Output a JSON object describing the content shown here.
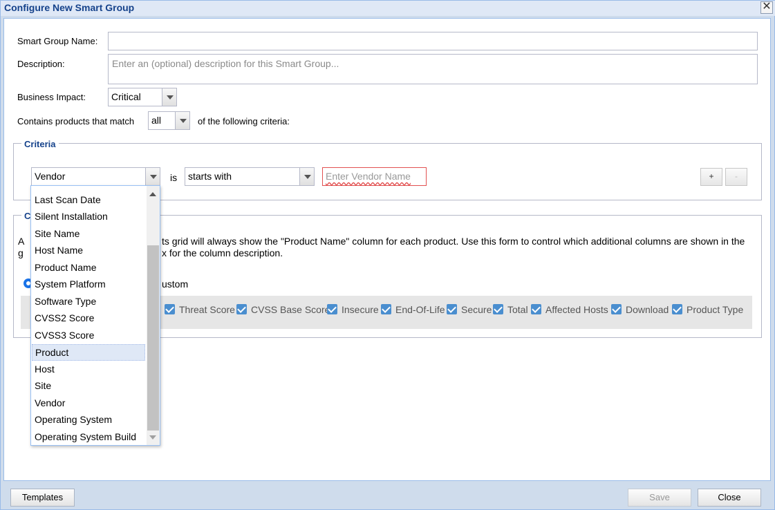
{
  "dialog": {
    "title": "Configure New Smart Group",
    "close_glyph": "✕"
  },
  "form": {
    "name_label": "Smart Group Name:",
    "name_value": "",
    "description_label": "Description:",
    "description_placeholder": "Enter an (optional) description for this Smart Group...",
    "impact_label": "Business Impact:",
    "impact_value": "Critical",
    "match_prefix": "Contains products that match",
    "match_value": "all",
    "match_suffix": "of the following criteria:"
  },
  "criteria": {
    "legend": "Criteria",
    "field_value": "Vendor",
    "is_label": "is",
    "operator_value": "starts with",
    "value_placeholder": "Enter Vendor Name",
    "add_label": "+",
    "remove_label": "-"
  },
  "columns": {
    "legend": "C",
    "desc_line1_start": "A",
    "desc_line1": "ts grid will always show the \"Product Name\" column for each product. Use this form to control which additional columns are shown in the",
    "desc_line2_start": "g",
    "desc_line2": "x for the column description.",
    "custom_label": "ustom",
    "checkboxes": [
      "Threat Score",
      "CVSS Base Score",
      "Insecure",
      "End-Of-Life",
      "Secure",
      "Total",
      "Affected Hosts",
      "Download",
      "Product Type"
    ]
  },
  "dropdown": {
    "items": [
      "Last Scan Date",
      "Silent Installation",
      "Site Name",
      "Host Name",
      "Product Name",
      "System Platform",
      "Software Type",
      "CVSS2 Score",
      "CVSS3 Score",
      "Product",
      "Host",
      "Site",
      "Vendor",
      "Operating System",
      "Operating System Build"
    ],
    "selected": "Product"
  },
  "footer": {
    "templates_label": "Templates",
    "save_label": "Save",
    "close_label": "Close"
  },
  "colors": {
    "title": "#15428b",
    "checkbox": "#4a8ecf",
    "invalid_border": "#e25050"
  }
}
